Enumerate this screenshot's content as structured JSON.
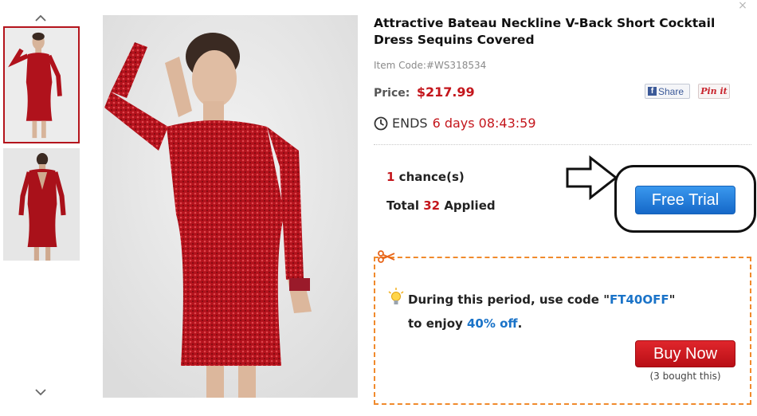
{
  "gallery": {
    "up_icon": "chevron-up-icon",
    "down_icon": "chevron-down-icon",
    "thumbnails": [
      {
        "view": "front",
        "selected": true
      },
      {
        "view": "back",
        "selected": false
      }
    ]
  },
  "product": {
    "title": "Attractive Bateau Neckline V-Back Short Cocktail Dress Sequins Covered",
    "item_code": "Item Code:#WS318534",
    "price_label": "Price:",
    "price": "$217.99",
    "ends_label": "ENDS",
    "ends_time": "6 days 08:43:59"
  },
  "share": {
    "facebook_label": "Share",
    "pinterest_label": "Pin it"
  },
  "trial": {
    "chances_count": "1",
    "chances_label": "chance(s)",
    "total_prefix": "Total",
    "applied_count": "32",
    "applied_suffix": "Applied",
    "button_label": "Free Trial"
  },
  "coupon": {
    "line1_prefix": "During this period, use code \"",
    "code": "FT40OFF",
    "line1_suffix": "\"",
    "line2_prefix": "to enjoy ",
    "discount": "40% off",
    "line2_suffix": ".",
    "button_label": "Buy Now",
    "bought_note": "(3 bought this)"
  },
  "colors": {
    "accent_red": "#c4161c",
    "accent_blue": "#1a73c8",
    "coupon_border": "#f08a2c"
  },
  "close_label": "×"
}
